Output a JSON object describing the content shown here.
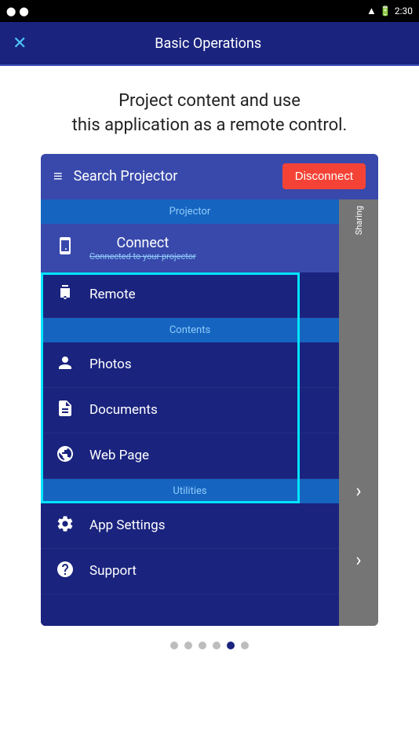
{
  "statusBar": {
    "time": "2:30",
    "batteryIcon": "🔋",
    "wifiIcon": "▲",
    "leftIcons": "⬤ ⬤"
  },
  "appBar": {
    "title": "Basic Operations",
    "closeLabel": "✕"
  },
  "description": {
    "line1": "Project content and use",
    "line2": "this application as a remote control."
  },
  "mockup": {
    "header": {
      "menuIcon": "≡",
      "searchLabel": "Search Projector",
      "disconnectLabel": "Disconnect"
    },
    "projectorSection": {
      "label": "Projector",
      "connectItem": {
        "label": "Connect",
        "subLabel": "Connected to your projector"
      }
    },
    "highlightedItems": [
      {
        "id": "remote",
        "label": "Remote",
        "iconType": "remote"
      }
    ],
    "contentsSection": {
      "label": "Contents",
      "items": [
        {
          "id": "photos",
          "label": "Photos",
          "iconType": "person"
        },
        {
          "id": "documents",
          "label": "Documents",
          "iconType": "document"
        },
        {
          "id": "webpage",
          "label": "Web Page",
          "iconType": "globe"
        }
      ]
    },
    "utilitiesSection": {
      "label": "Utilities",
      "items": [
        {
          "id": "appsettings",
          "label": "App Settings",
          "iconType": "gear"
        },
        {
          "id": "support",
          "label": "Support",
          "iconType": "help"
        }
      ]
    },
    "rightPanel": {
      "sharingLabel": "Sharing",
      "arrows": [
        "›",
        "›"
      ]
    }
  },
  "pagination": {
    "dots": [
      false,
      false,
      false,
      false,
      true,
      false
    ]
  }
}
